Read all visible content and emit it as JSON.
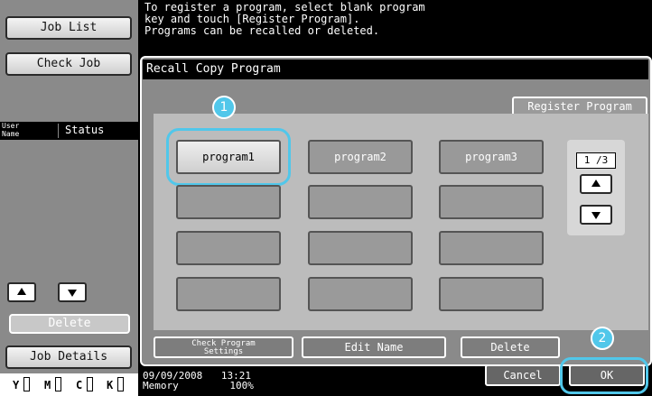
{
  "left_panel": {
    "job_list": "Job List",
    "check_job": "Check Job",
    "user_name": "User\nName",
    "status": "Status",
    "delete": "Delete",
    "job_details": "Job Details",
    "toner": [
      {
        "letter": "Y"
      },
      {
        "letter": "M"
      },
      {
        "letter": "C"
      },
      {
        "letter": "K"
      }
    ]
  },
  "instruction": "To register a program, select blank program\nkey and touch [Register Program].\nPrograms can be recalled or deleted.",
  "dialog": {
    "title": "Recall Copy Program",
    "register_program": "Register Program",
    "programs": [
      "program1",
      "program2",
      "program3"
    ],
    "page_indicator": "1 /3",
    "check_program_settings": "Check Program\nSettings",
    "edit_name": "Edit Name",
    "delete": "Delete",
    "cancel": "Cancel",
    "ok": "OK"
  },
  "callouts": [
    "1",
    "2"
  ],
  "status_bar": {
    "date": "09/09/2008",
    "time": "13:21",
    "memory_label": "Memory",
    "memory_value": "100%"
  },
  "colors": {
    "highlight": "#51c7ea",
    "panel": "#8a8a8a"
  }
}
